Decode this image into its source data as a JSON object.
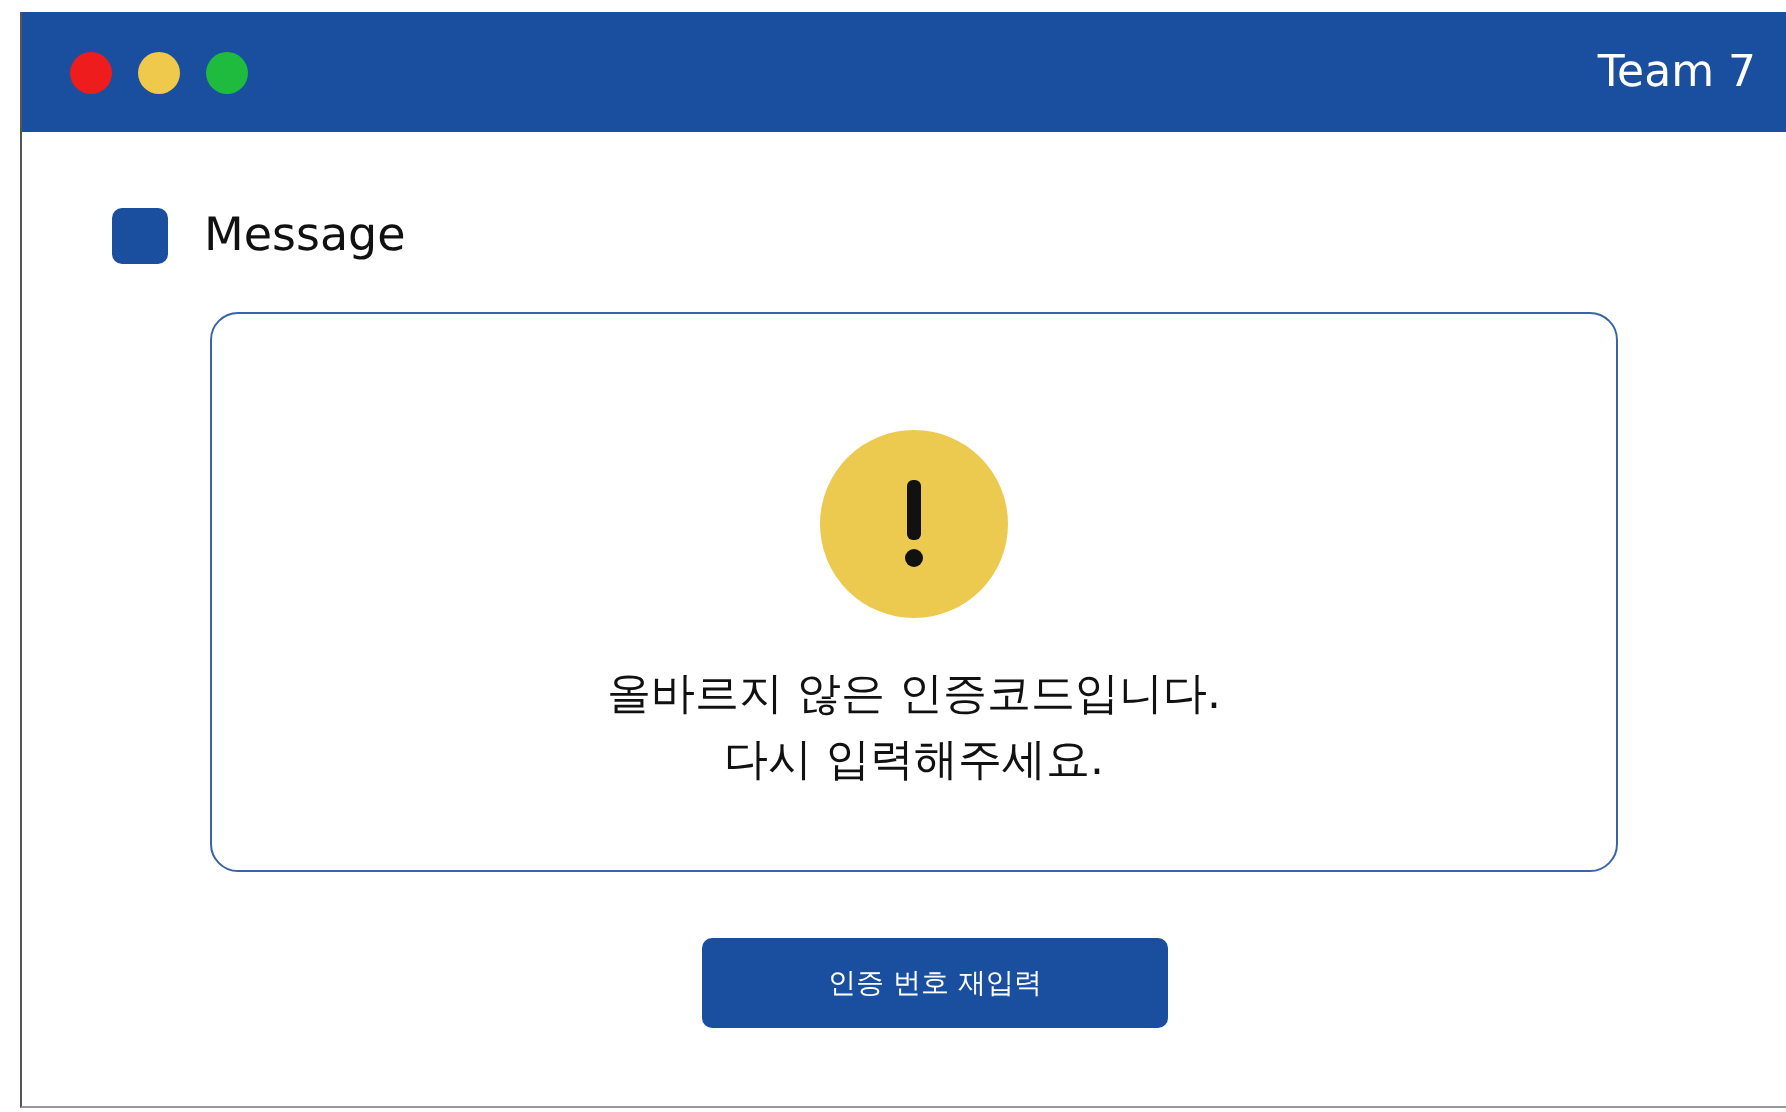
{
  "window": {
    "title": "Team 7",
    "controls": [
      {
        "color": "#ee1c1c"
      },
      {
        "color": "#efc94c"
      },
      {
        "color": "#1fbb3f"
      }
    ]
  },
  "section": {
    "title": "Message"
  },
  "alert": {
    "kind": "warning",
    "lines": [
      "올바르지 않은 인증코드입니다.",
      "다시 입력해주세요."
    ]
  },
  "button": {
    "label": "인증 번호 재입력"
  }
}
